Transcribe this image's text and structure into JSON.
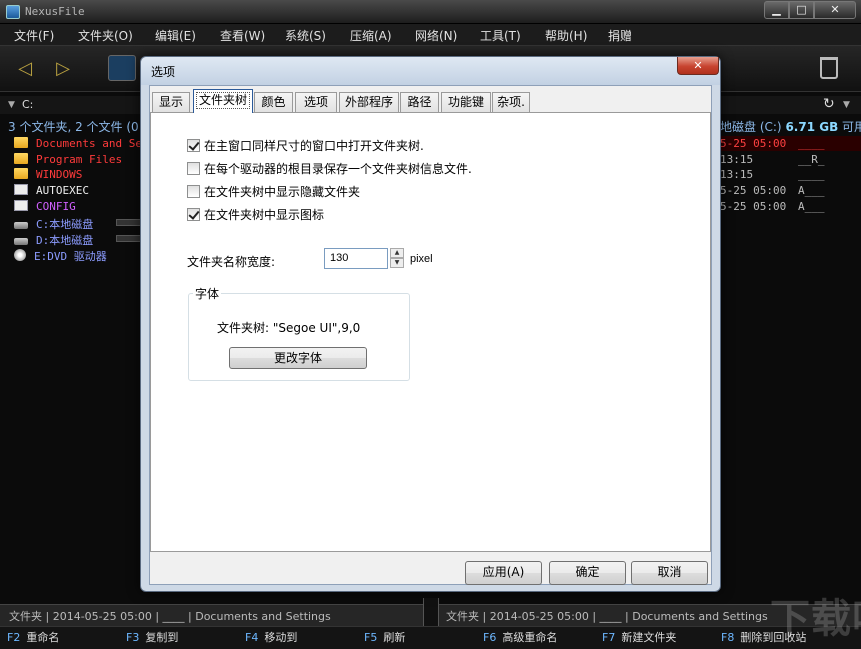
{
  "app": {
    "title": "NexusFile",
    "controls": {
      "minimize": "▁",
      "maximize": "□",
      "close": "✕"
    }
  },
  "menu": [
    "文件(F)",
    "文件夹(O)",
    "编辑(E)",
    "查看(W)",
    "系统(S)",
    "压缩(A)",
    "网络(N)",
    "工具(T)",
    "帮助(H)",
    "捐赠"
  ],
  "left_panel": {
    "drive": "C:",
    "summary": "3 个文件夹, 2 个文件 (0",
    "files": [
      {
        "name": "Documents and Set",
        "color": "#ff3b3b"
      },
      {
        "name": "Program Files",
        "color": "#ff3b3b"
      },
      {
        "name": "WINDOWS",
        "color": "#ff3b3b"
      },
      {
        "name": "AUTOEXEC",
        "color": "#eeeeee"
      },
      {
        "name": "CONFIG",
        "color": "#d060ff"
      },
      {
        "name": "C:本地磁盘",
        "color": "#8c9cff"
      },
      {
        "name": "D:本地磁盘",
        "color": "#8c9cff"
      },
      {
        "name": "E:DVD 驱动器",
        "color": "#8c9cff"
      }
    ]
  },
  "right_panel": {
    "summary_prefix": "地磁盘 (C:)",
    "summary_size": "6.71 GB",
    "summary_suffix": "可用",
    "rows": [
      {
        "time": "5-25  05:00",
        "attr": "____",
        "color": "#ff4040"
      },
      {
        "time": "      13:15",
        "attr": "__R_",
        "color": "#bbbbbb"
      },
      {
        "time": "      13:15",
        "attr": "____",
        "color": "#bbbbbb"
      },
      {
        "time": "5-25  05:00",
        "attr": "A___",
        "color": "#bbbbbb"
      },
      {
        "time": "5-25  05:00",
        "attr": "A___",
        "color": "#bbbbbb"
      }
    ]
  },
  "status": {
    "left": "文件夹  |  2014-05-25 05:00  |  ____  |  Documents and Settings",
    "right": "文件夹  |  2014-05-25 05:00  |  ____  |  Documents and Settings"
  },
  "fkeys": [
    {
      "key": "F2",
      "label": "重命名"
    },
    {
      "key": "F3",
      "label": "复制到"
    },
    {
      "key": "F4",
      "label": "移动到"
    },
    {
      "key": "F5",
      "label": "刷新"
    },
    {
      "key": "F6",
      "label": "高级重命名"
    },
    {
      "key": "F7",
      "label": "新建文件夹"
    },
    {
      "key": "F8",
      "label": "删除到回收站"
    }
  ],
  "watermark": "下载吧",
  "dialog": {
    "title": "选项",
    "close": "✕",
    "tabs": [
      "显示",
      "文件夹树",
      "颜色",
      "选项",
      "外部程序",
      "路径",
      "功能键",
      "杂项."
    ],
    "active_tab": 1,
    "checkboxes": [
      {
        "label": "在主窗口同样尺寸的窗口中打开文件夹树.",
        "checked": true
      },
      {
        "label": "在每个驱动器的根目录保存一个文件夹树信息文件.",
        "checked": false
      },
      {
        "label": "在文件夹树中显示隐藏文件夹",
        "checked": false
      },
      {
        "label": "在文件夹树中显示图标",
        "checked": true
      }
    ],
    "folder_width_label": "文件夹名称宽度:",
    "folder_width_value": "130",
    "folder_width_unit": "pixel",
    "font_group_title": "字体",
    "font_desc": "文件夹树: \"Segoe UI\",9,0",
    "change_font_label": "更改字体",
    "buttons": {
      "apply": "应用(A)",
      "ok": "确定",
      "cancel": "取消"
    }
  }
}
